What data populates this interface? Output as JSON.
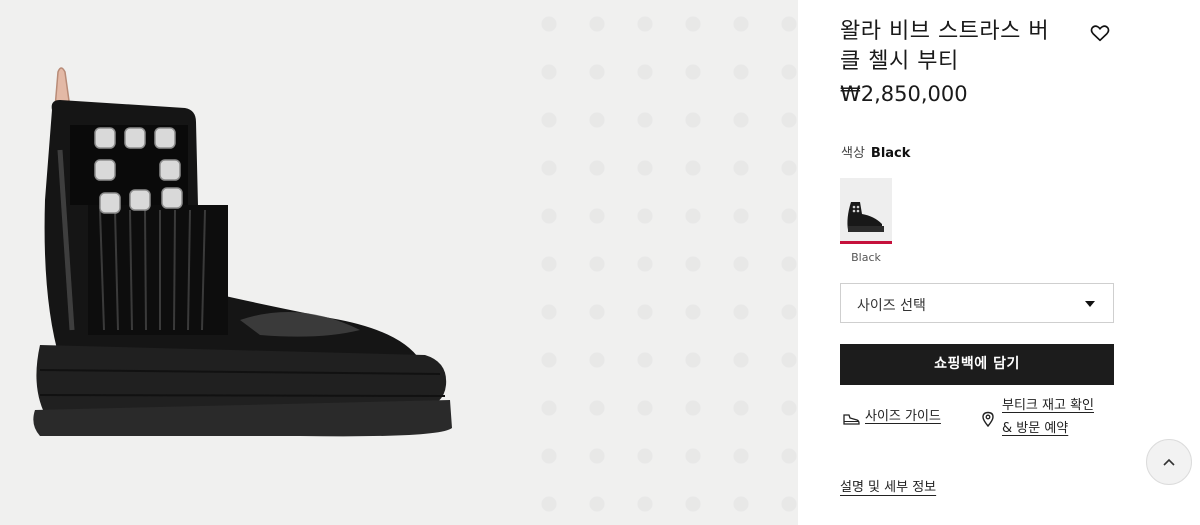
{
  "product": {
    "title": "왈라 비브 스트라스 버클 첼시 부티",
    "price": "₩2,850,000",
    "image_alt": "black patent chelsea bootie with crystal buckle"
  },
  "color": {
    "label": "색상",
    "selected": "Black",
    "swatches": [
      {
        "label": "Black",
        "accent": "#c5103b"
      }
    ]
  },
  "size_select": {
    "placeholder": "사이즈 선택"
  },
  "actions": {
    "add_to_bag": "쇼핑백에 담기",
    "size_guide": "사이즈 가이드",
    "boutique_line1": "부티크 재고 확인",
    "boutique_line2": "& 방문 예약",
    "details": "설명 및 세부 정보"
  },
  "icons": {
    "wishlist": "heart-icon",
    "size_guide": "shoe-icon",
    "boutique": "location-pin-icon",
    "scroll_top": "chevron-up-icon",
    "dropdown": "caret-down-icon"
  },
  "colors": {
    "button_bg": "#1c1c1c",
    "selected_swatch_border": "#c5103b",
    "gallery_bg": "#f0f0ef"
  }
}
